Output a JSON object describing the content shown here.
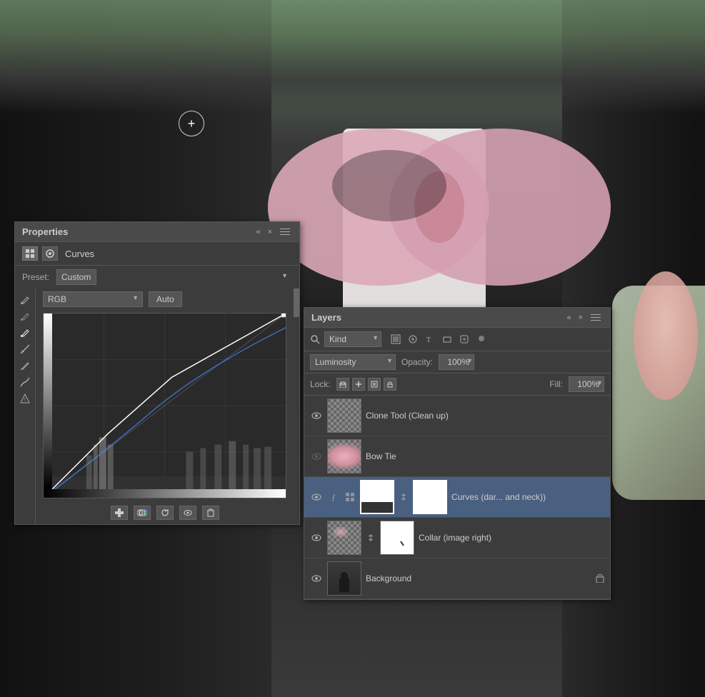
{
  "background": {
    "description": "Wedding photo - man in dark suit with pink bow tie"
  },
  "cursor": {
    "symbol": "+"
  },
  "properties_panel": {
    "title": "Properties",
    "close_btn": "×",
    "collapse_btn": "«",
    "tab_icon1": "grid",
    "tab_icon2": "circle",
    "curves_label": "Curves",
    "preset_label": "Preset:",
    "preset_value": "Custom",
    "channel_value": "RGB",
    "auto_btn": "Auto",
    "bottom_icons": [
      "frame",
      "eye-circle",
      "undo",
      "eye",
      "trash"
    ]
  },
  "layers_panel": {
    "title": "Layers",
    "collapse_btn": "«",
    "close_btn": "×",
    "kind_label": "Kind",
    "blend_mode": "Luminosity",
    "opacity_label": "Opacity:",
    "opacity_value": "100%",
    "lock_label": "Lock:",
    "fill_label": "Fill:",
    "fill_value": "100%",
    "filter_icons": [
      "image",
      "brush",
      "text",
      "shape",
      "fx",
      "dot"
    ],
    "layers": [
      {
        "name": "Clone Tool (Clean up)",
        "visible": true,
        "has_checkerboard": true,
        "type": "pixel"
      },
      {
        "name": "Bow Tie",
        "visible": false,
        "has_checkerboard": true,
        "type": "pixel"
      },
      {
        "name": "Curves (dar... and neck))",
        "visible": true,
        "has_checkerboard": false,
        "has_mask": true,
        "type": "adjustment",
        "has_f_icon": true,
        "has_grid_icon": true,
        "has_link": true
      },
      {
        "name": "Collar (image right)",
        "visible": true,
        "has_checkerboard": true,
        "has_mask": true,
        "has_link": true,
        "type": "pixel"
      },
      {
        "name": "Background",
        "visible": true,
        "has_checkerboard": false,
        "type": "pixel"
      }
    ]
  }
}
